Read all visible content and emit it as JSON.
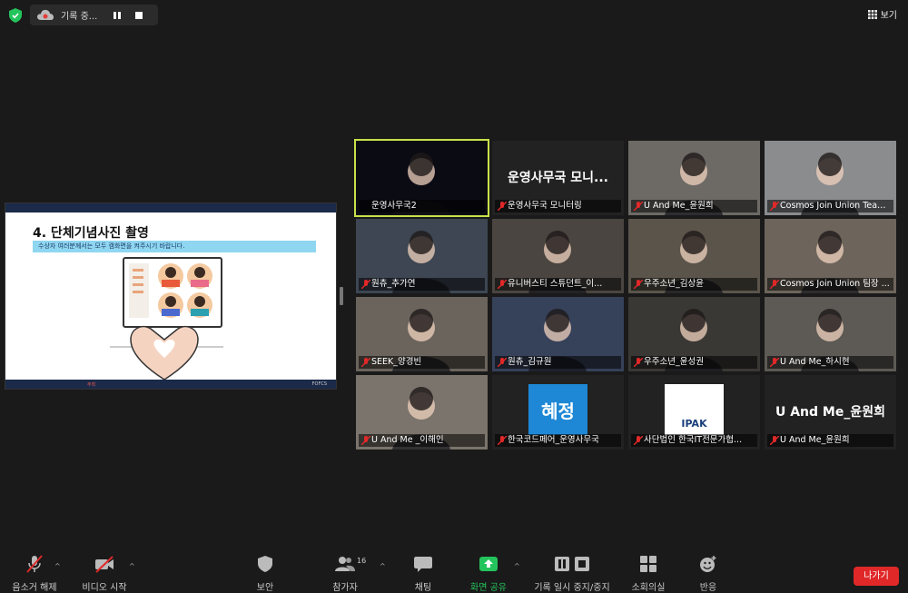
{
  "topbar": {
    "recording_label": "기록 중...",
    "view_label": "보기"
  },
  "share": {
    "title": "4. 단체기념사진 촬영",
    "subtitle": "수상자 여러분께서는 모두 캠화면을 켜주시기 바랍니다.",
    "footer_left": "주최",
    "footer_right": "FOFCS"
  },
  "tiles": [
    {
      "name": "운영사무국2",
      "big": "",
      "muted": false,
      "bg": "#0b0b14"
    },
    {
      "name": "운영사무국 모니터링",
      "big": "운영사무국 모니...",
      "muted": true,
      "bg": "#222"
    },
    {
      "name": "U And Me_윤원희",
      "big": "",
      "muted": true,
      "bg": "#6d6a66"
    },
    {
      "name": "Cosmos Join Union Team ...",
      "big": "",
      "muted": true,
      "bg": "#8a8c8e"
    },
    {
      "name": "원츄_추가연",
      "big": "",
      "muted": true,
      "bg": "#3d4652"
    },
    {
      "name": "유니버스티 스튜던트_이...",
      "big": "",
      "muted": true,
      "bg": "#4a4540"
    },
    {
      "name": "우주소년_김상윤",
      "big": "",
      "muted": true,
      "bg": "#5a544b"
    },
    {
      "name": "Cosmos Join Union 팀장 ...",
      "big": "",
      "muted": true,
      "bg": "#6d655c"
    },
    {
      "name": "SEEK_양경빈",
      "big": "",
      "muted": true,
      "bg": "#6a645c"
    },
    {
      "name": "원츄_김규원",
      "big": "",
      "muted": true,
      "bg": "#36415a"
    },
    {
      "name": "우주소년_윤성권",
      "big": "",
      "muted": true,
      "bg": "#3a3835"
    },
    {
      "name": "U And Me_하시현",
      "big": "",
      "muted": true,
      "bg": "#5d5a55"
    },
    {
      "name": "U And Me _이해인",
      "big": "",
      "muted": true,
      "bg": "#7a746c"
    },
    {
      "name": "한국코드페어_운영사무국",
      "big": "",
      "muted": true,
      "bg": "#222",
      "logo": "혜정"
    },
    {
      "name": "사단법인 한국IT전문가협...",
      "big": "",
      "muted": true,
      "bg": "#222",
      "logo": "IPAK"
    },
    {
      "name": "U And Me_윤원희",
      "big": "U And Me_윤원희",
      "muted": true,
      "bg": "#222"
    }
  ],
  "toolbar": {
    "mute_label": "음소거 해제",
    "video_label": "비디오 시작",
    "security_label": "보안",
    "participants_label": "참가자",
    "participants_count": "16",
    "chat_label": "채팅",
    "share_label": "화면 공유",
    "record_label": "기록 일시 중지/중지",
    "breakout_label": "소회의실",
    "reactions_label": "반응",
    "leave_label": "나가기"
  },
  "colors": {
    "accent_green": "#24c45c",
    "active_outline": "#c8e14a",
    "leave_red": "#e02828"
  }
}
